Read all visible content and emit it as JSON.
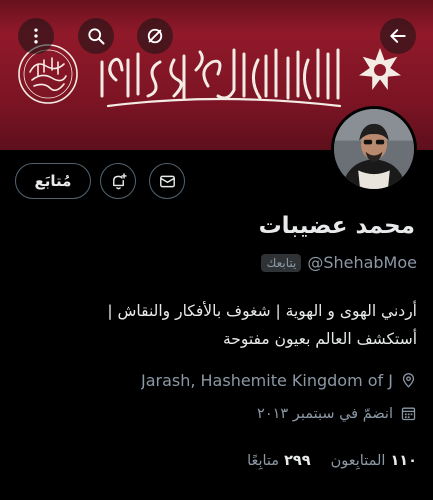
{
  "header": {
    "back_icon": "arrow-left-icon",
    "search_icon": "search-icon",
    "mute_icon": "mute-circle-icon",
    "more_icon": "more-vertical-icon"
  },
  "banner": {
    "colors": {
      "top": "#9b1b2c",
      "bottom": "#5e0f1c"
    },
    "main_calligraphy_text": "لا إله إلا الله محمد رسول الله"
  },
  "actions": {
    "follow_label": "مُتابَع",
    "notifications_icon": "bell-plus-icon",
    "message_icon": "envelope-icon"
  },
  "profile": {
    "display_name": "محمد عضيبات",
    "handle": "@ShehabMoe",
    "follows_you_badge": "يتابعك",
    "bio_line_1": "أردني الهوى و الهوية | شغوف بالأفكار والنقاش |",
    "bio_line_2": "أستكشف العالم بعيون مفتوحة",
    "location": "Jarash, Hashemite Kingdom of J",
    "joined": "انضمّ في سبتمبر ٢٠١٣"
  },
  "stats": {
    "followers_count": "١١٠",
    "followers_label": "المتابِعون",
    "following_count": "٢٩٩",
    "following_label": "متابِعًا"
  },
  "colors": {
    "background": "#000000",
    "text_primary": "#e7e9ea",
    "text_secondary": "#8b98a5",
    "border": "#536471"
  }
}
